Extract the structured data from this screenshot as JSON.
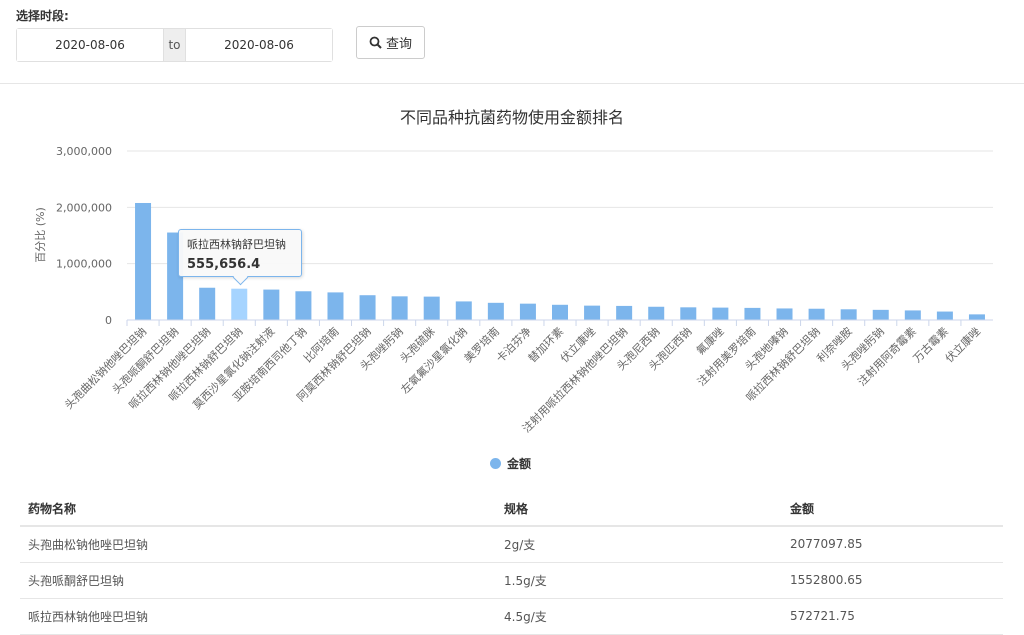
{
  "filter": {
    "label": "选择时段:",
    "start_date": "2020-08-06",
    "to_label": "to",
    "end_date": "2020-08-06",
    "query_label": "查询"
  },
  "colors": {
    "bar": "#7cb5ec",
    "bar_hover": "#a6d4ff",
    "grid": "#e6e6e6"
  },
  "chart_data": {
    "type": "bar",
    "title": "不同品种抗菌药物使用金额排名",
    "ylabel": "百分比 (%)",
    "xlabel": "",
    "ylim": [
      0,
      3000000
    ],
    "yticks": [
      "0",
      "1,000,000",
      "2,000,000",
      "3,000,000"
    ],
    "grid": true,
    "legend_position": "bottom-center",
    "categories": [
      "头孢曲松钠他唑巴坦钠",
      "头孢哌酮舒巴坦钠",
      "哌拉西林钠他唑巴坦钠",
      "哌拉西林钠舒巴坦钠",
      "莫西沙星氯化钠注射液",
      "亚胺培南西司他丁钠",
      "比阿培南",
      "阿莫西林钠舒巴坦钠",
      "头孢唑肟钠",
      "头孢硫脒",
      "左氧氟沙星氯化钠",
      "美罗培南",
      "卡泊芬净",
      "替加环素",
      "伏立康唑",
      "注射用哌拉西林钠他唑巴坦钠",
      "头孢尼西钠",
      "头孢匹西钠",
      "氟康唑",
      "注射用美罗培南",
      "头孢地嗪钠",
      "哌拉西林钠舒巴坦钠",
      "利奈唑胺",
      "头孢唑肟钠",
      "注射用阿奇霉素",
      "万古霉素",
      "伏立康唑"
    ],
    "series": [
      {
        "name": "金额",
        "values": [
          2077097.85,
          1552800.65,
          572721.75,
          555656.4,
          540000,
          510000,
          490000,
          440000,
          420000,
          415000,
          330000,
          305000,
          290000,
          270000,
          255000,
          250000,
          235000,
          225000,
          220000,
          215000,
          205000,
          200000,
          190000,
          180000,
          170000,
          150000,
          100000
        ]
      }
    ],
    "highlight_index": 3,
    "tooltip": {
      "label": "哌拉西林钠舒巴坦钠",
      "value": "555,656.4"
    }
  },
  "table": {
    "headers": [
      "药物名称",
      "规格",
      "金额"
    ],
    "rows": [
      [
        "头孢曲松钠他唑巴坦钠",
        "2g/支",
        "2077097.85"
      ],
      [
        "头孢哌酮舒巴坦钠",
        "1.5g/支",
        "1552800.65"
      ],
      [
        "哌拉西林钠他唑巴坦钠",
        "4.5g/支",
        "572721.75"
      ]
    ]
  }
}
